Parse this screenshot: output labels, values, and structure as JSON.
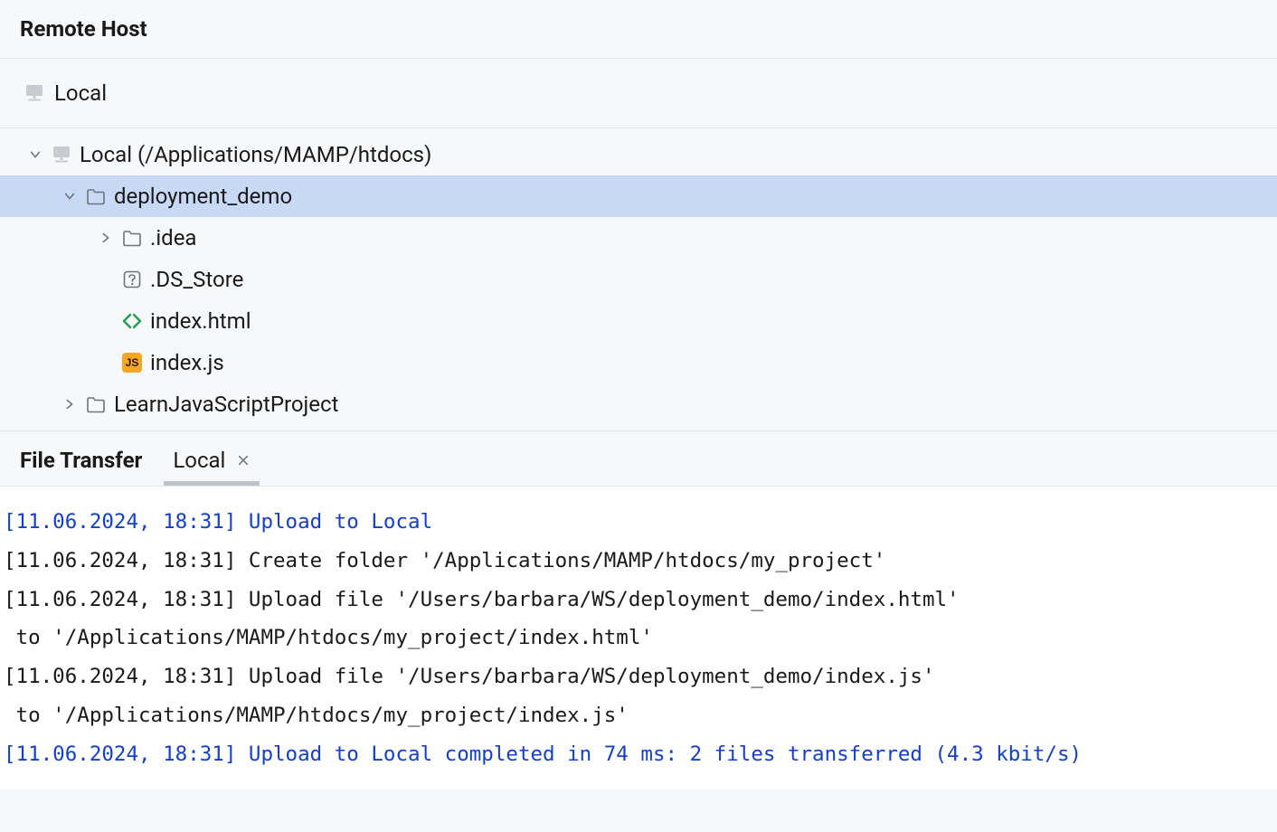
{
  "panel": {
    "title": "Remote Host"
  },
  "server": {
    "label": "Local"
  },
  "tree": {
    "root": {
      "label": "Local (/Applications/MAMP/htdocs)"
    },
    "items": [
      {
        "label": "deployment_demo"
      },
      {
        "label": ".idea"
      },
      {
        "label": ".DS_Store"
      },
      {
        "label": "index.html"
      },
      {
        "label": "index.js"
      },
      {
        "label": "LearnJavaScriptProject"
      }
    ]
  },
  "tabs": {
    "left": "File Transfer",
    "active": "Local"
  },
  "log": {
    "lines": [
      {
        "style": "blue",
        "text": "[11.06.2024, 18:31] Upload to Local"
      },
      {
        "style": "plain",
        "text": "[11.06.2024, 18:31] Create folder '/Applications/MAMP/htdocs/my_project'"
      },
      {
        "style": "plain",
        "text": "[11.06.2024, 18:31] Upload file '/Users/barbara/WS/deployment_demo/index.html'"
      },
      {
        "style": "plain",
        "text": " to '/Applications/MAMP/htdocs/my_project/index.html'"
      },
      {
        "style": "plain",
        "text": "[11.06.2024, 18:31] Upload file '/Users/barbara/WS/deployment_demo/index.js'"
      },
      {
        "style": "plain",
        "text": " to '/Applications/MAMP/htdocs/my_project/index.js'"
      },
      {
        "style": "blue",
        "text": "[11.06.2024, 18:31] Upload to Local completed in 74 ms: 2 files transferred (4.3 kbit/s)"
      }
    ]
  }
}
